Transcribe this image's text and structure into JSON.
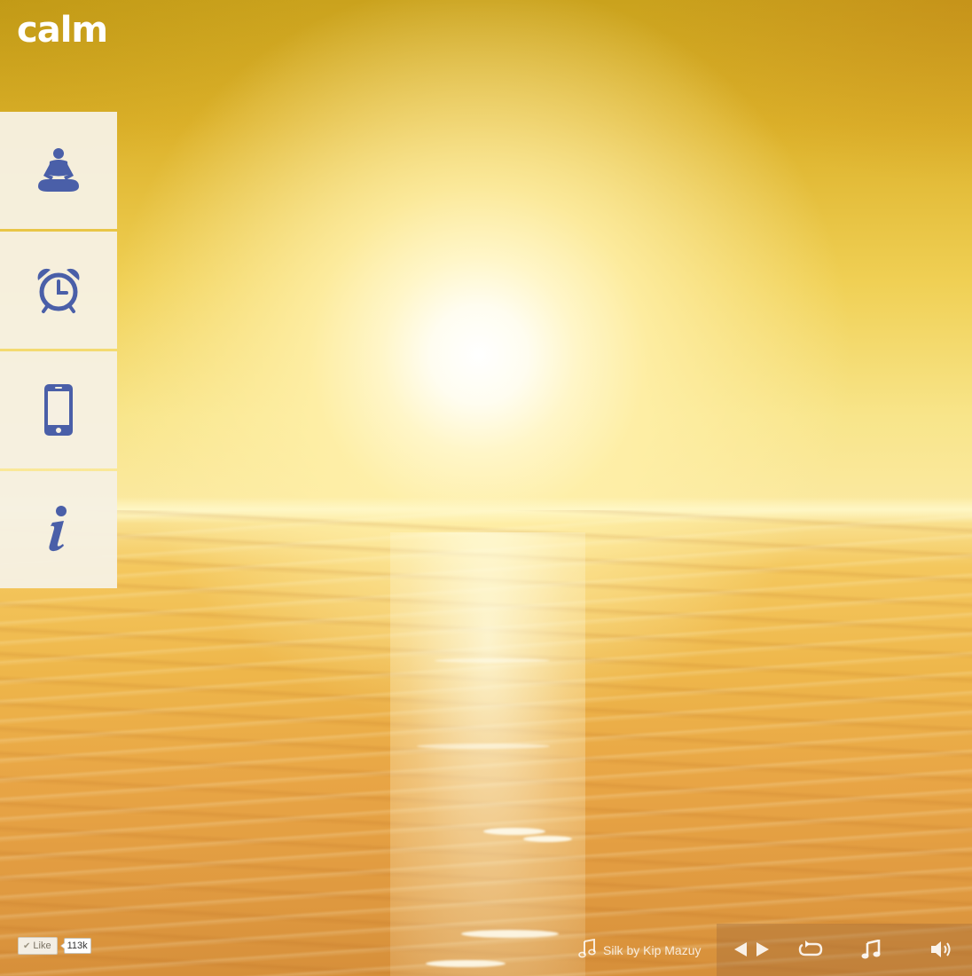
{
  "brand": {
    "logo_text": "calm"
  },
  "sidebar": {
    "items": [
      {
        "id": "meditate",
        "icon": "meditation-figure-icon"
      },
      {
        "id": "timer",
        "icon": "alarm-clock-icon"
      },
      {
        "id": "mobile-app",
        "icon": "smartphone-icon"
      },
      {
        "id": "info",
        "icon": "info-icon"
      }
    ]
  },
  "social": {
    "like_label": "Like",
    "like_count": "113k"
  },
  "player": {
    "track_label": "Silk by Kip Mazuy",
    "controls": [
      "previous-icon",
      "next-icon",
      "repeat-icon",
      "music-note-icon",
      "volume-icon"
    ]
  },
  "colors": {
    "icon_blue": "#4a5fa8",
    "nav_bg": "#f6f0e2",
    "sky_top": "#caa21d",
    "water": "#e8a545"
  }
}
